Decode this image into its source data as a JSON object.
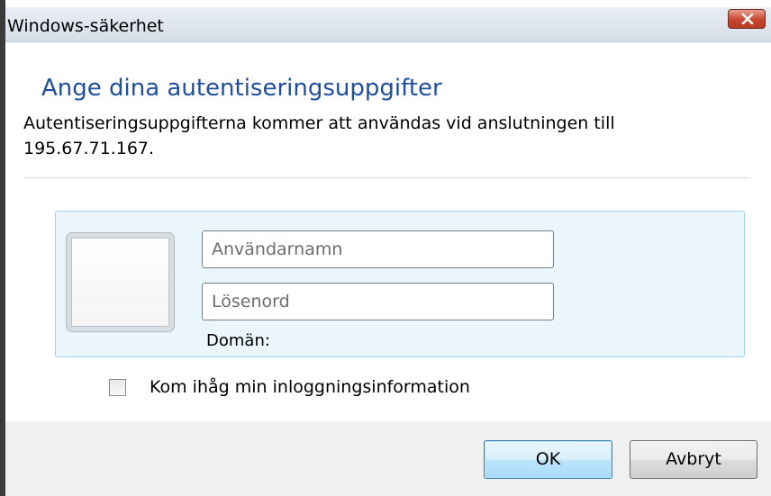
{
  "window": {
    "title": "Windows-säkerhet"
  },
  "dialog": {
    "heading": "Ange dina autentiseringsuppgifter",
    "description": "Autentiseringsuppgifterna kommer att användas vid anslutningen till 195.67.71.167."
  },
  "credentials": {
    "username_placeholder": "Användarnamn",
    "password_placeholder": "Lösenord",
    "domain_label": "Domän:"
  },
  "remember": {
    "label": "Kom ihåg min inloggningsinformation",
    "checked": false
  },
  "buttons": {
    "ok_label": "OK",
    "cancel_label": "Avbryt"
  },
  "icons": {
    "close": "close-icon",
    "user_tile": "user-tile-icon"
  },
  "colors": {
    "heading": "#1e4fa0",
    "close_button": "#c8452f",
    "credential_panel": "#eaf6fb",
    "footer": "#f0f0f0"
  }
}
